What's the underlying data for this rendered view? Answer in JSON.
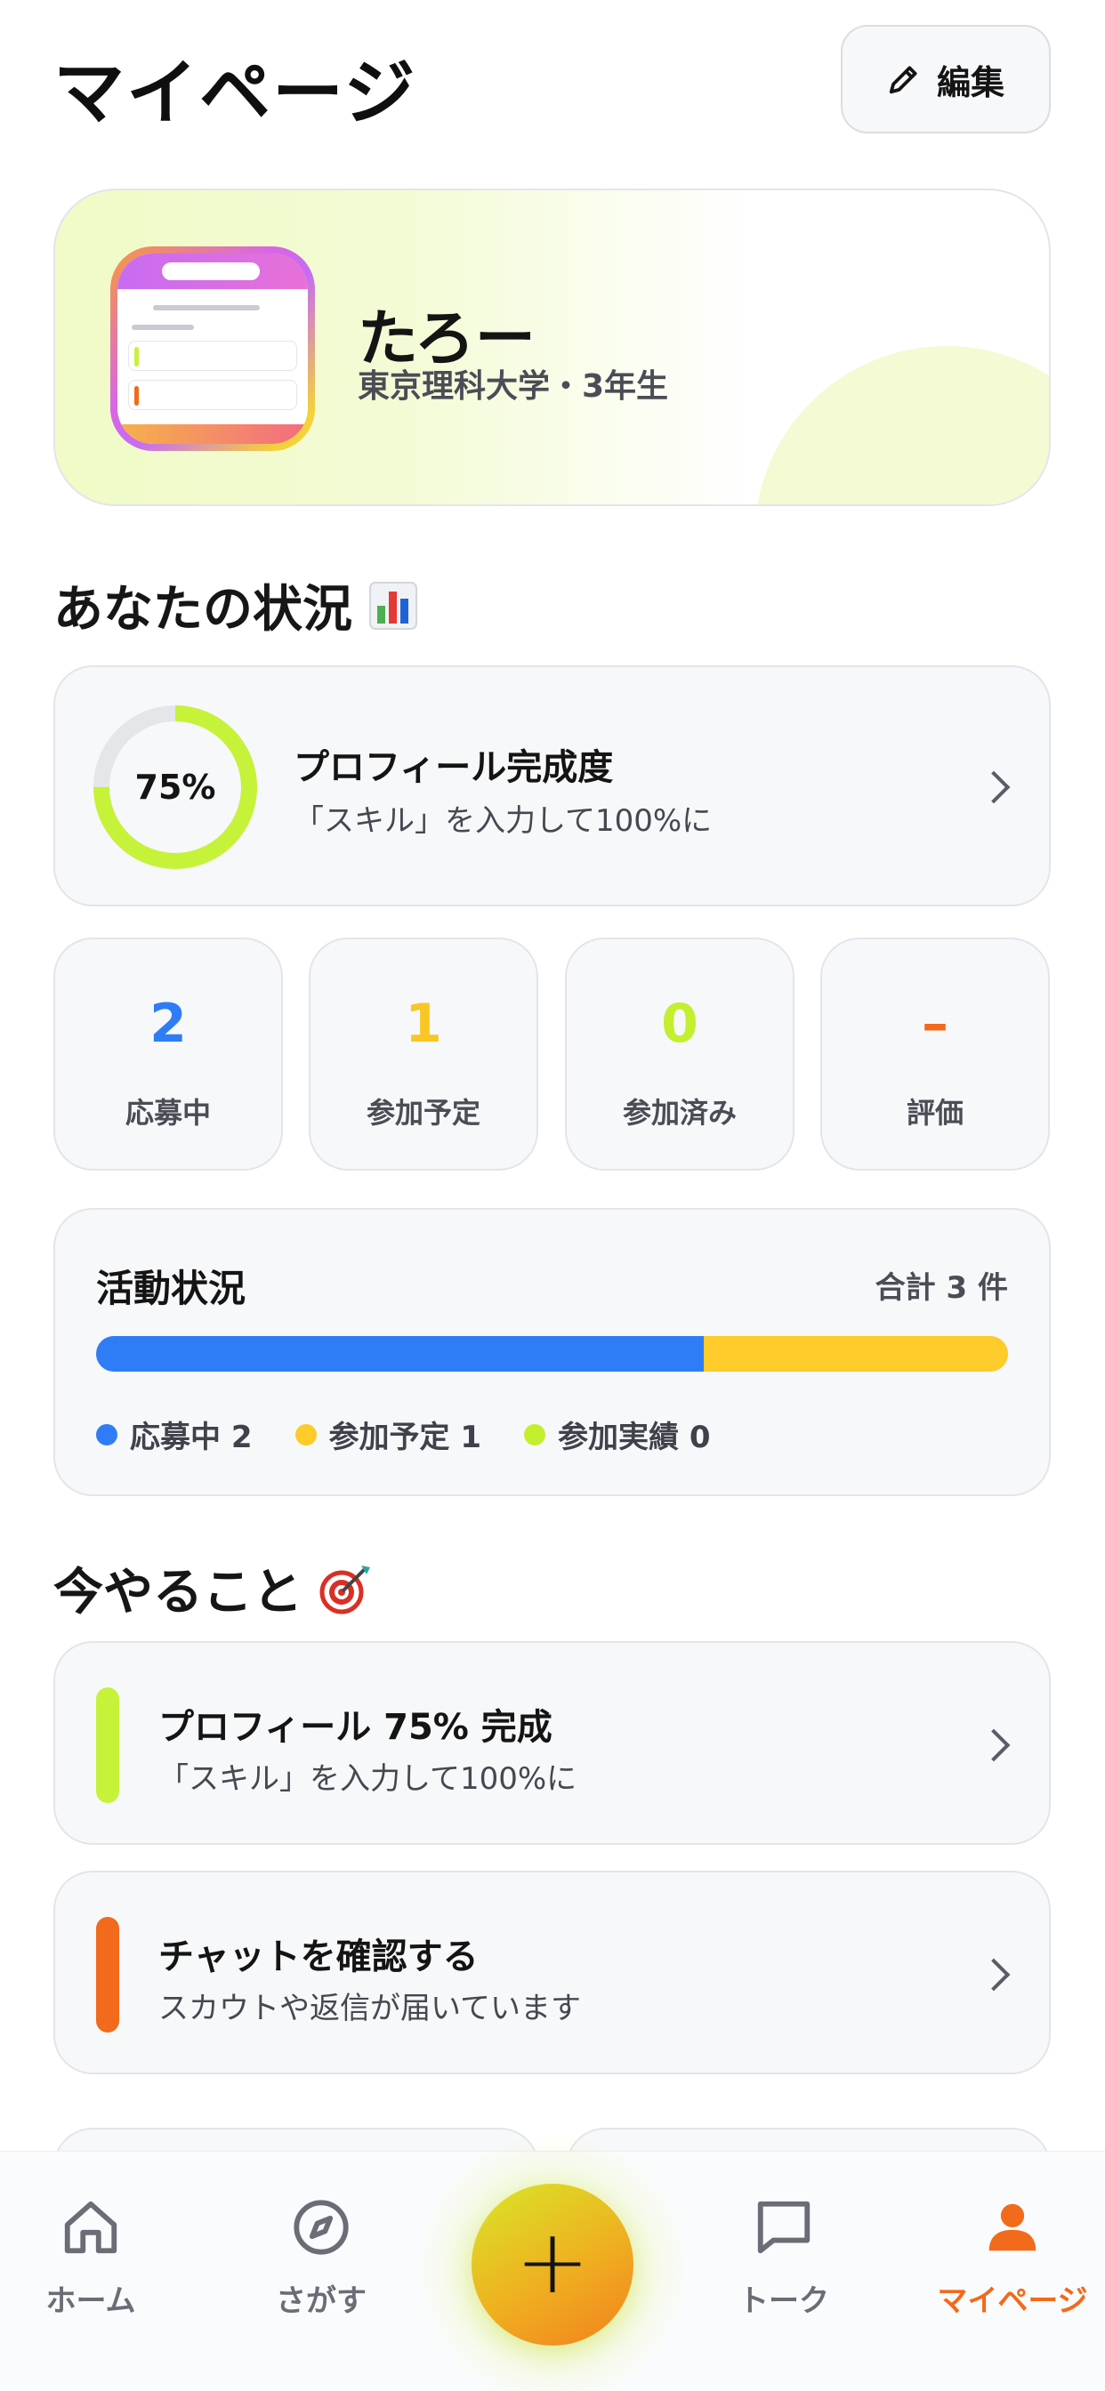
{
  "header": {
    "title": "マイページ",
    "edit_label": "編集"
  },
  "profile": {
    "name": "たろー",
    "subtitle": "東京理科大学・3年生"
  },
  "status_section": {
    "title": "あなたの状況",
    "icon": "bar-chart-icon"
  },
  "profile_progress": {
    "percent_label": "75%",
    "percent": 0.75,
    "title": "プロフィール完成度",
    "subtitle": "「スキル」を入力して100%に",
    "ring_color": "#c7f23a",
    "track_color": "#e4e6ea"
  },
  "stats": [
    {
      "value": "2",
      "label": "応募中",
      "color": "#2f7df6"
    },
    {
      "value": "1",
      "label": "参加予定",
      "color": "#f9c623"
    },
    {
      "value": "0",
      "label": "参加済み",
      "color": "#c3ef2f"
    },
    {
      "value": "–",
      "label": "評価",
      "color": "#f26a1b"
    }
  ],
  "activity": {
    "title": "活動状況",
    "total": "合計 3 件",
    "segments": [
      {
        "label": "応募中 2",
        "count": 2,
        "color": "#2f7df6"
      },
      {
        "label": "参加予定 1",
        "count": 1,
        "color": "#fdcb2a"
      },
      {
        "label": "参加実績 0",
        "count": 0,
        "color": "#c3ef2f"
      }
    ]
  },
  "todo_section": {
    "title": "今やること",
    "icon": "target-dart-icon"
  },
  "todos": [
    {
      "title": "プロフィール 75% 完成",
      "subtitle": "「スキル」を入力して100%に",
      "color": "#c7f23a"
    },
    {
      "title": "チャットを確認する",
      "subtitle": "スカウトや返信が届いています",
      "color": "#f26a1b"
    }
  ],
  "nav": {
    "home": "ホーム",
    "search": "さがす",
    "add": "+",
    "talk": "トーク",
    "mypage": "マイページ",
    "active_color": "#f26a1b"
  }
}
